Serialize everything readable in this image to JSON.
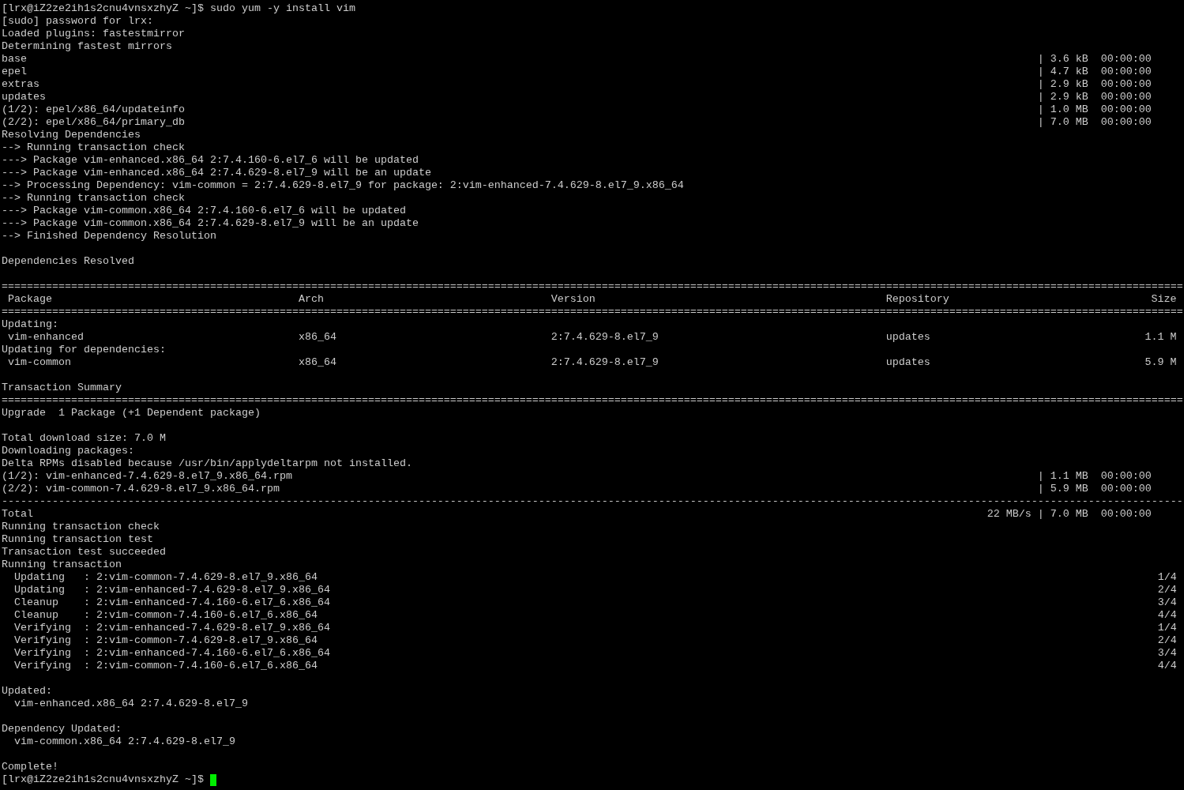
{
  "terminal": {
    "lines": [
      {
        "kind": "prompt",
        "prompt": "[lrx@iZ2ze2ih1s2cnu4vnsxzhyZ ~]$",
        "command": "sudo yum -y install vim"
      },
      {
        "kind": "text",
        "text": "[sudo] password for lrx:"
      },
      {
        "kind": "text",
        "text": "Loaded plugins: fastestmirror"
      },
      {
        "kind": "text",
        "text": "Determining fastest mirrors"
      },
      {
        "kind": "download",
        "text": "base",
        "stats": "| 3.6 kB  00:00:00"
      },
      {
        "kind": "download",
        "text": "epel",
        "stats": "| 4.7 kB  00:00:00"
      },
      {
        "kind": "download",
        "text": "extras",
        "stats": "| 2.9 kB  00:00:00"
      },
      {
        "kind": "download",
        "text": "updates",
        "stats": "| 2.9 kB  00:00:00"
      },
      {
        "kind": "download",
        "text": "(1/2): epel/x86_64/updateinfo",
        "stats": "| 1.0 MB  00:00:00"
      },
      {
        "kind": "download",
        "text": "(2/2): epel/x86_64/primary_db",
        "stats": "| 7.0 MB  00:00:00"
      },
      {
        "kind": "text",
        "text": "Resolving Dependencies"
      },
      {
        "kind": "text",
        "text": "--> Running transaction check"
      },
      {
        "kind": "text",
        "text": "---> Package vim-enhanced.x86_64 2:7.4.160-6.el7_6 will be updated"
      },
      {
        "kind": "text",
        "text": "---> Package vim-enhanced.x86_64 2:7.4.629-8.el7_9 will be an update"
      },
      {
        "kind": "text",
        "text": "--> Processing Dependency: vim-common = 2:7.4.629-8.el7_9 for package: 2:vim-enhanced-7.4.629-8.el7_9.x86_64"
      },
      {
        "kind": "text",
        "text": "--> Running transaction check"
      },
      {
        "kind": "text",
        "text": "---> Package vim-common.x86_64 2:7.4.160-6.el7_6 will be updated"
      },
      {
        "kind": "text",
        "text": "---> Package vim-common.x86_64 2:7.4.629-8.el7_9 will be an update"
      },
      {
        "kind": "text",
        "text": "--> Finished Dependency Resolution"
      },
      {
        "kind": "blank"
      },
      {
        "kind": "text",
        "text": "Dependencies Resolved"
      },
      {
        "kind": "blank"
      },
      {
        "kind": "rule",
        "text": "==========================================================================================================================================================================================="
      },
      {
        "kind": "table_header",
        "cells": [
          "Package",
          "Arch",
          "Version",
          "Repository",
          "Size"
        ]
      },
      {
        "kind": "rule",
        "text": "==========================================================================================================================================================================================="
      },
      {
        "kind": "text",
        "text": "Updating:"
      },
      {
        "kind": "table_row",
        "cells": [
          "vim-enhanced",
          "x86_64",
          "2:7.4.629-8.el7_9",
          "updates",
          "1.1 M"
        ]
      },
      {
        "kind": "text",
        "text": "Updating for dependencies:"
      },
      {
        "kind": "table_row",
        "cells": [
          "vim-common",
          "x86_64",
          "2:7.4.629-8.el7_9",
          "updates",
          "5.9 M"
        ]
      },
      {
        "kind": "blank"
      },
      {
        "kind": "text",
        "text": "Transaction Summary"
      },
      {
        "kind": "rule",
        "text": "==========================================================================================================================================================================================="
      },
      {
        "kind": "text",
        "text": "Upgrade  1 Package (+1 Dependent package)"
      },
      {
        "kind": "blank"
      },
      {
        "kind": "text",
        "text": "Total download size: 7.0 M"
      },
      {
        "kind": "text",
        "text": "Downloading packages:"
      },
      {
        "kind": "text",
        "text": "Delta RPMs disabled because /usr/bin/applydeltarpm not installed."
      },
      {
        "kind": "download",
        "text": "(1/2): vim-enhanced-7.4.629-8.el7_9.x86_64.rpm",
        "stats": "| 1.1 MB  00:00:00"
      },
      {
        "kind": "download",
        "text": "(2/2): vim-common-7.4.629-8.el7_9.x86_64.rpm",
        "stats": "| 5.9 MB  00:00:00"
      },
      {
        "kind": "rule",
        "text": "-------------------------------------------------------------------------------------------------------------------------------------------------------------------------------------------"
      },
      {
        "kind": "download",
        "text": "Total",
        "stats": "22 MB/s | 7.0 MB  00:00:00"
      },
      {
        "kind": "text",
        "text": "Running transaction check"
      },
      {
        "kind": "text",
        "text": "Running transaction test"
      },
      {
        "kind": "text",
        "text": "Transaction test succeeded"
      },
      {
        "kind": "text",
        "text": "Running transaction"
      },
      {
        "kind": "step",
        "text": "Updating   : 2:vim-common-7.4.629-8.el7_9.x86_64",
        "counter": "1/4"
      },
      {
        "kind": "step",
        "text": "Updating   : 2:vim-enhanced-7.4.629-8.el7_9.x86_64",
        "counter": "2/4"
      },
      {
        "kind": "step",
        "text": "Cleanup    : 2:vim-enhanced-7.4.160-6.el7_6.x86_64",
        "counter": "3/4"
      },
      {
        "kind": "step",
        "text": "Cleanup    : 2:vim-common-7.4.160-6.el7_6.x86_64",
        "counter": "4/4"
      },
      {
        "kind": "step",
        "text": "Verifying  : 2:vim-enhanced-7.4.629-8.el7_9.x86_64",
        "counter": "1/4"
      },
      {
        "kind": "step",
        "text": "Verifying  : 2:vim-common-7.4.629-8.el7_9.x86_64",
        "counter": "2/4"
      },
      {
        "kind": "step",
        "text": "Verifying  : 2:vim-enhanced-7.4.160-6.el7_6.x86_64",
        "counter": "3/4"
      },
      {
        "kind": "step",
        "text": "Verifying  : 2:vim-common-7.4.160-6.el7_6.x86_64",
        "counter": "4/4"
      },
      {
        "kind": "blank"
      },
      {
        "kind": "text",
        "text": "Updated:"
      },
      {
        "kind": "indented",
        "text": "vim-enhanced.x86_64 2:7.4.629-8.el7_9"
      },
      {
        "kind": "blank"
      },
      {
        "kind": "text",
        "text": "Dependency Updated:"
      },
      {
        "kind": "indented",
        "text": "vim-common.x86_64 2:7.4.629-8.el7_9"
      },
      {
        "kind": "blank"
      },
      {
        "kind": "text",
        "text": "Complete!"
      },
      {
        "kind": "prompt",
        "prompt": "[lrx@iZ2ze2ih1s2cnu4vnsxzhyZ ~]$",
        "cursor": true
      }
    ]
  }
}
